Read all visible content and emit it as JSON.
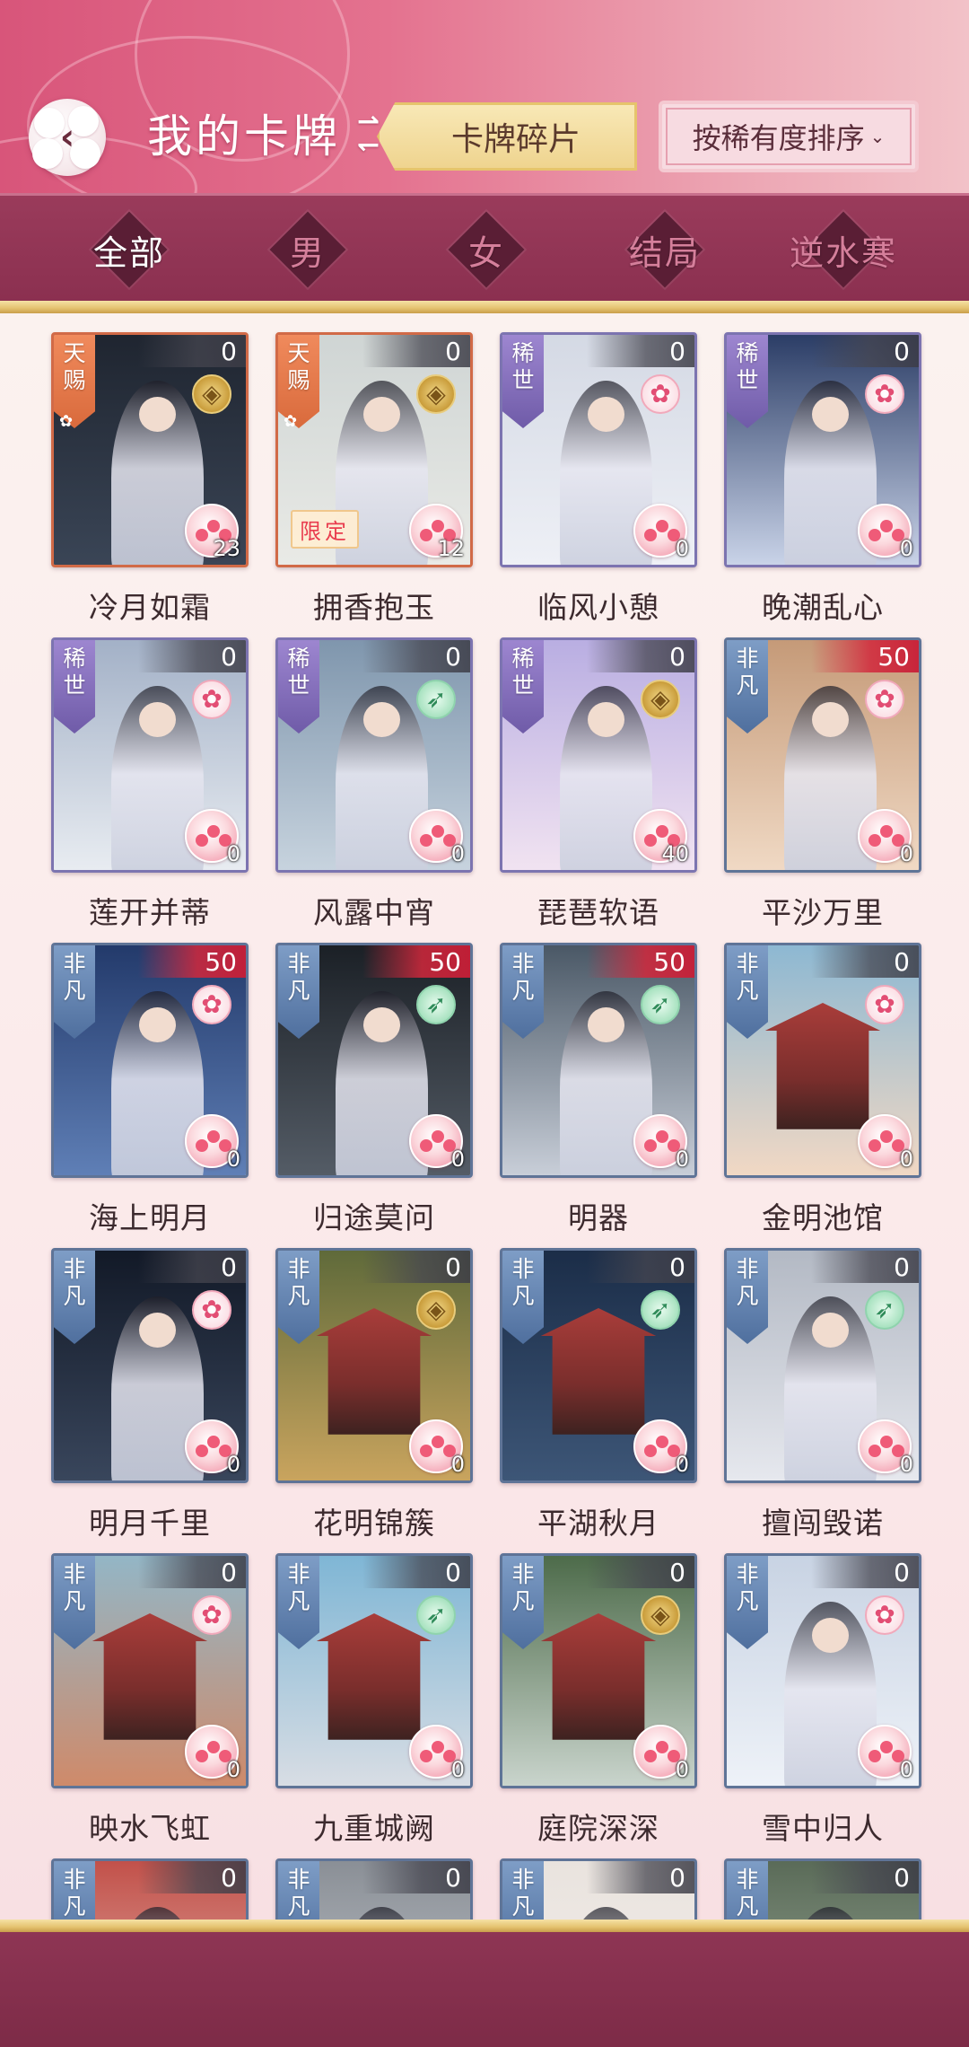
{
  "header": {
    "title": "我的卡牌",
    "fragments_label": "卡牌碎片",
    "sort_label": "按稀有度排序",
    "sort_caret": "⌄",
    "back_glyph": "‹",
    "swap_glyphs": [
      "⇀",
      "↽"
    ]
  },
  "filters": [
    {
      "label": "全部",
      "active": true
    },
    {
      "label": "男",
      "active": false
    },
    {
      "label": "女",
      "active": false
    },
    {
      "label": "结局",
      "active": false
    },
    {
      "label": "逆水寒",
      "active": false
    }
  ],
  "rarity_labels": {
    "tianci": [
      "天",
      "赐"
    ],
    "xishi": [
      "稀",
      "世"
    ],
    "feifan": [
      "非",
      "凡"
    ]
  },
  "limited_label": "限定",
  "icons": {
    "coin": "coin-icon",
    "flower": "plum-blossom-icon",
    "bow": "bow-icon",
    "fragment": "fragment-icon"
  },
  "colors": {
    "header_pink": "#d8557a",
    "bar_maroon": "#8b3050",
    "gold": "#e4c26f",
    "tianci_orange": "#d96a3c",
    "xishi_purple": "#6f5ba8",
    "feifan_blue": "#4f6f9e"
  },
  "cards": [
    {
      "name": "冷月如霜",
      "rarity": "tianci",
      "count": "0",
      "fragments": "23",
      "type": "coin",
      "limited": false,
      "bg": [
        "#1f2530",
        "#3a4556"
      ],
      "kind": "figure"
    },
    {
      "name": "拥香抱玉",
      "rarity": "tianci",
      "count": "0",
      "fragments": "12",
      "type": "coin",
      "limited": true,
      "bg": [
        "#cfd5d4",
        "#e9eae6"
      ],
      "kind": "figure"
    },
    {
      "name": "临风小憩",
      "rarity": "xishi",
      "count": "0",
      "fragments": "0",
      "type": "flower",
      "limited": false,
      "bg": [
        "#d4d9e4",
        "#eef0f6"
      ],
      "kind": "figure"
    },
    {
      "name": "晚潮乱心",
      "rarity": "xishi",
      "count": "0",
      "fragments": "0",
      "type": "flower",
      "limited": false,
      "bg": [
        "#2b3d66",
        "#c9d3e8"
      ],
      "kind": "figure"
    },
    {
      "name": "莲开并蒂",
      "rarity": "xishi",
      "count": "0",
      "fragments": "0",
      "type": "flower",
      "limited": false,
      "bg": [
        "#a3b1c7",
        "#e8ecf1"
      ],
      "kind": "figure"
    },
    {
      "name": "风露中宵",
      "rarity": "xishi",
      "count": "0",
      "fragments": "0",
      "type": "bow",
      "limited": false,
      "bg": [
        "#7f96ad",
        "#c7d3de"
      ],
      "kind": "figure"
    },
    {
      "name": "琵琶软语",
      "rarity": "xishi",
      "count": "0",
      "fragments": "40",
      "type": "coin",
      "limited": false,
      "bg": [
        "#b9aee2",
        "#f1e3f1"
      ],
      "kind": "figure"
    },
    {
      "name": "平沙万里",
      "rarity": "feifan",
      "count": "50",
      "fragments": "0",
      "type": "flower",
      "limited": false,
      "bg": [
        "#c59a78",
        "#f0d9c4"
      ],
      "kind": "figure"
    },
    {
      "name": "海上明月",
      "rarity": "feifan",
      "count": "50",
      "fragments": "0",
      "type": "flower",
      "limited": false,
      "bg": [
        "#233a6b",
        "#5f7fb6"
      ],
      "kind": "figure"
    },
    {
      "name": "归途莫问",
      "rarity": "feifan",
      "count": "50",
      "fragments": "0",
      "type": "bow",
      "limited": false,
      "bg": [
        "#1b2026",
        "#545c66"
      ],
      "kind": "figure"
    },
    {
      "name": "明器",
      "rarity": "feifan",
      "count": "50",
      "fragments": "0",
      "type": "bow",
      "limited": false,
      "bg": [
        "#4a5866",
        "#c8ced8"
      ],
      "kind": "figure"
    },
    {
      "name": "金明池馆",
      "rarity": "feifan",
      "count": "0",
      "fragments": "0",
      "type": "flower",
      "limited": false,
      "bg": [
        "#8db8d2",
        "#f1d8c4"
      ],
      "kind": "building"
    },
    {
      "name": "明月千里",
      "rarity": "feifan",
      "count": "0",
      "fragments": "0",
      "type": "flower",
      "limited": false,
      "bg": [
        "#121927",
        "#39465c"
      ],
      "kind": "figure"
    },
    {
      "name": "花明锦簇",
      "rarity": "feifan",
      "count": "0",
      "fragments": "0",
      "type": "coin",
      "limited": false,
      "bg": [
        "#5f6a3a",
        "#c9a45e"
      ],
      "kind": "building"
    },
    {
      "name": "平湖秋月",
      "rarity": "feifan",
      "count": "0",
      "fragments": "0",
      "type": "bow",
      "limited": false,
      "bg": [
        "#1b2d48",
        "#3d5677"
      ],
      "kind": "building"
    },
    {
      "name": "擅闯毁诺",
      "rarity": "feifan",
      "count": "0",
      "fragments": "0",
      "type": "bow",
      "limited": false,
      "bg": [
        "#b3b9c4",
        "#e6e8ee"
      ],
      "kind": "figure"
    },
    {
      "name": "映水飞虹",
      "rarity": "feifan",
      "count": "0",
      "fragments": "0",
      "type": "flower",
      "limited": false,
      "bg": [
        "#93b6c6",
        "#cf8a6a"
      ],
      "kind": "building"
    },
    {
      "name": "九重城阙",
      "rarity": "feifan",
      "count": "0",
      "fragments": "0",
      "type": "bow",
      "limited": false,
      "bg": [
        "#7fb6d5",
        "#d8dde4"
      ],
      "kind": "building"
    },
    {
      "name": "庭院深深",
      "rarity": "feifan",
      "count": "0",
      "fragments": "0",
      "type": "coin",
      "limited": false,
      "bg": [
        "#4d6b4a",
        "#c9d4cc"
      ],
      "kind": "building"
    },
    {
      "name": "雪中归人",
      "rarity": "feifan",
      "count": "0",
      "fragments": "0",
      "type": "flower",
      "limited": false,
      "bg": [
        "#c8d3e3",
        "#eef2f8"
      ],
      "kind": "figure"
    },
    {
      "name": "",
      "rarity": "feifan",
      "count": "0",
      "fragments": "",
      "type": "",
      "limited": false,
      "bg": [
        "#c2514a",
        "#e8c8c0"
      ],
      "kind": "figure"
    },
    {
      "name": "",
      "rarity": "feifan",
      "count": "0",
      "fragments": "",
      "type": "",
      "limited": false,
      "bg": [
        "#8a8f96",
        "#cfd3d8"
      ],
      "kind": "figure"
    },
    {
      "name": "",
      "rarity": "feifan",
      "count": "0",
      "fragments": "",
      "type": "",
      "limited": false,
      "bg": [
        "#e9e3de",
        "#f6f1ee"
      ],
      "kind": "figure"
    },
    {
      "name": "",
      "rarity": "feifan",
      "count": "0",
      "fragments": "",
      "type": "",
      "limited": false,
      "bg": [
        "#5a6b58",
        "#a9b6a6"
      ],
      "kind": "figure"
    }
  ]
}
